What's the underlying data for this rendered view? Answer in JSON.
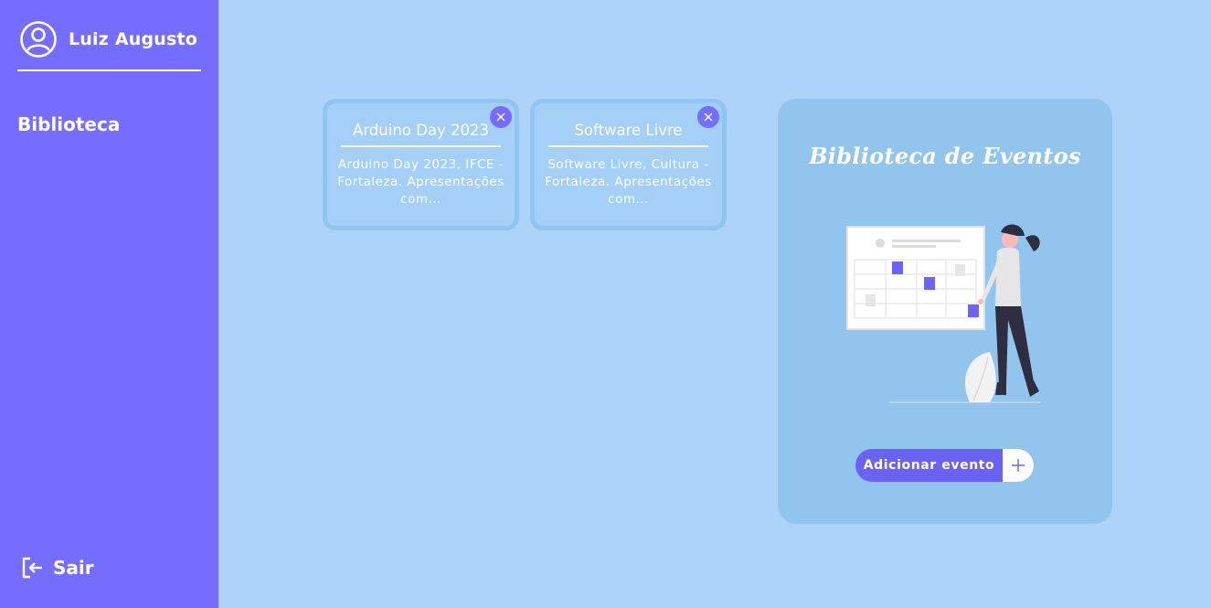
{
  "sidebar": {
    "user_name": "Luiz Augusto",
    "nav_label": "Biblioteca",
    "logout_label": "Sair",
    "avatar_icon": "user-circle-icon",
    "logout_icon": "logout-icon"
  },
  "events": [
    {
      "title": "Arduino Day 2023",
      "description": "Arduino Day 2023, IFCE - Fortaleza. Apresentações com..."
    },
    {
      "title": "Software Livre",
      "description": "Software Livre, Cultura - Fortaleza. Apresentações com..."
    }
  ],
  "panel": {
    "title": "Biblioteca de Eventos",
    "add_button_label": "Adicionar evento",
    "add_icon": "plus-icon",
    "illustration": "calendar-woman-illustration"
  },
  "colors": {
    "sidebar": "#756dff",
    "background": "#add3f8",
    "panel": "#92c5ee",
    "accent": "#6a62f2"
  }
}
